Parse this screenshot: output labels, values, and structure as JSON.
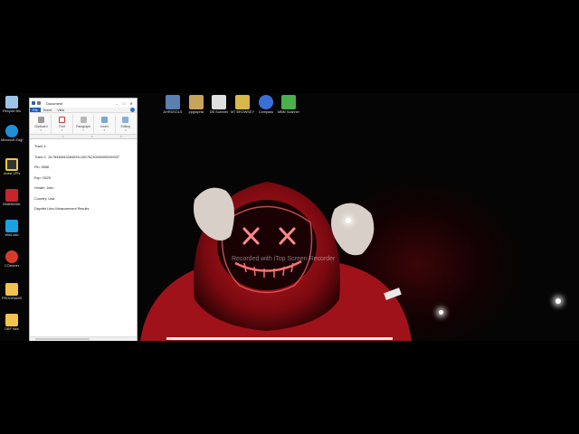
{
  "wordpad": {
    "title": "Document",
    "menu": {
      "file": "File",
      "home": "Home",
      "view": "View"
    },
    "ribbon": [
      "Clipboard",
      "Font",
      "Paragraph",
      "Insert",
      "Editing"
    ],
    "ruler": [
      "1",
      "2",
      "3"
    ],
    "lines": [
      "Track 1:",
      "Track 2: ;5178346810284093=45176230000000000037",
      "Pin: 5558",
      "Exp: 03/25",
      "Holder: John",
      "Country: Usa",
      "Dayofet Urno Measurement Results"
    ]
  },
  "desktop": {
    "left_icons": [
      {
        "label": "Recycle Bin",
        "color": "#9ec3e6"
      },
      {
        "label": "Microsoft Edge",
        "color": "#1f8fd6"
      },
      {
        "label": "Avast VPN",
        "color": "#e8c94a"
      },
      {
        "label": "Bitdefender",
        "color": "#c8242b"
      },
      {
        "label": "WinLoad",
        "color": "#1ba1e2"
      },
      {
        "label": "CCleaner",
        "color": "#d83b2a"
      },
      {
        "label": "PROGRAMS",
        "color": "#f2c14e"
      },
      {
        "label": "DBF files",
        "color": "#f2c14e"
      }
    ],
    "top_icons": [
      {
        "label": "AHRDSOLS",
        "color": "#5a7fb0"
      },
      {
        "label": "ppgraphic",
        "color": "#c9a35a"
      },
      {
        "label": "DB Scanner",
        "color": "#e0e0e0"
      },
      {
        "label": "MT BROWSE PROC - Sh...",
        "color": "#d6b84b"
      },
      {
        "label": "Compass",
        "color": "#3b6fd8"
      },
      {
        "label": "MBM Scanner",
        "color": "#4bb04b"
      }
    ],
    "watermark": "Recorded with iTop Screen Recorder"
  }
}
